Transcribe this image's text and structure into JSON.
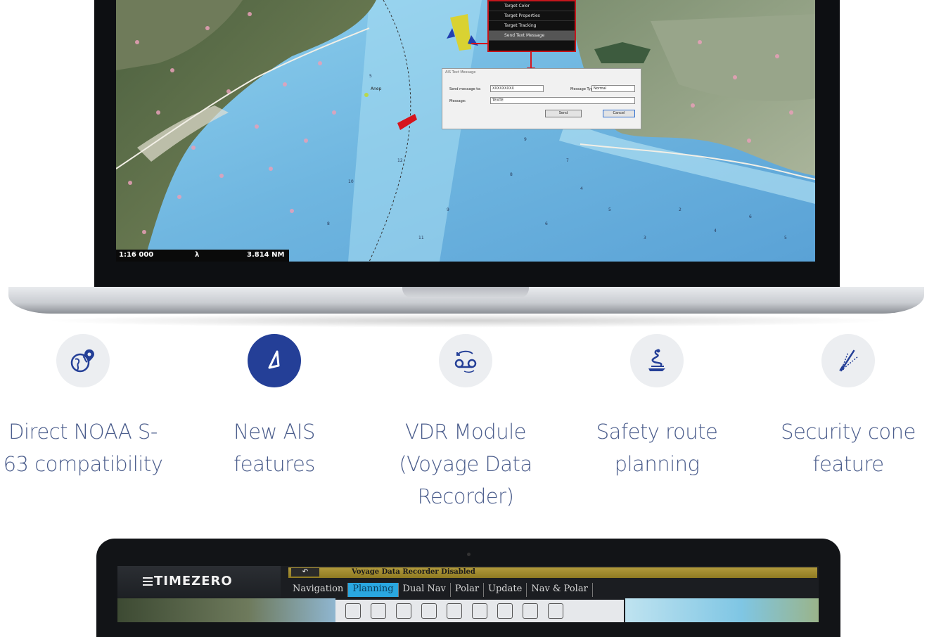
{
  "top_laptop": {
    "scale_label": "1:16 000",
    "range_label": "3.814 NM",
    "north_symbol": "λ",
    "vessel_label": "Anep",
    "context_menu": {
      "items": [
        "Target Color",
        "Target Properties",
        "Target Tracking",
        "Send Text Message"
      ]
    },
    "dialog": {
      "title": "AIS Text Message",
      "send_to_label": "Send message to:",
      "send_to_value": "XXXXXXXXX",
      "message_type_label": "Message Type:",
      "message_type_value": "Normal",
      "message_label": "Message:",
      "message_value": "TEXTE",
      "send_button": "Send",
      "cancel_button": "Cancel"
    }
  },
  "features": [
    {
      "icon": "globe-pin-icon",
      "line1": "Direct NOAA S-",
      "line2": "63 compatibility",
      "line3": ""
    },
    {
      "icon": "ais-triangle-icon",
      "line1": "New AIS",
      "line2": "features",
      "line3": ""
    },
    {
      "icon": "voicemail-icon",
      "line1": "VDR Module",
      "line2": "(Voyage Data",
      "line3": "Recorder)"
    },
    {
      "icon": "route-icon",
      "line1": "Safety route",
      "line2": "planning",
      "line3": ""
    },
    {
      "icon": "security-cone-icon",
      "line1": "Security cone",
      "line2": "feature",
      "line3": ""
    }
  ],
  "bottom_laptop": {
    "brand": "TIMEZERO",
    "banner": "Voyage Data Recorder Disabled",
    "undo_symbol": "↶",
    "tabs": [
      "Navigation",
      "Planning",
      "Dual Nav",
      "Polar",
      "Update",
      "Nav & Polar"
    ],
    "active_tab": "Planning"
  },
  "colors": {
    "feature_text": "#4b5d8c",
    "active_icon_bg": "#243f97",
    "icon_bg": "#eceef1",
    "sea": "#6fb6e0",
    "banner": "#a48d32"
  }
}
